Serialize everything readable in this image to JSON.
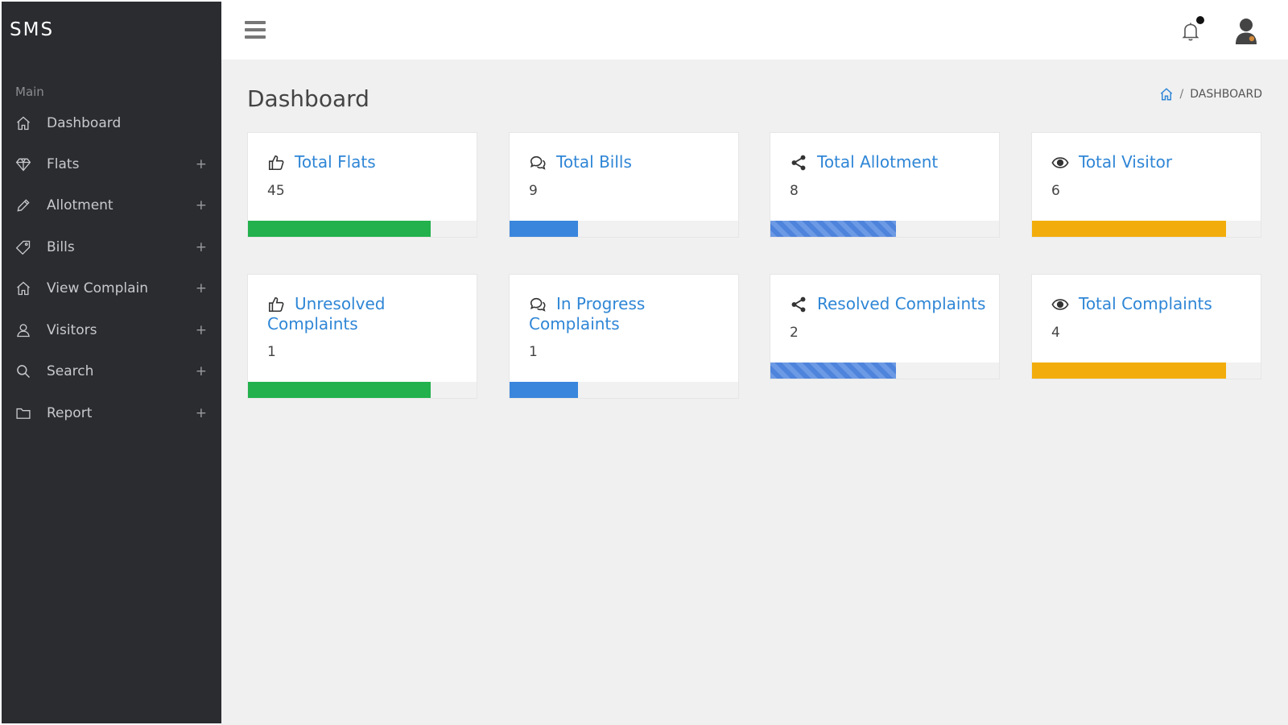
{
  "sidebar": {
    "brand": "SMS",
    "section": "Main",
    "items": [
      {
        "label": "Dashboard",
        "icon": "home-icon",
        "expandable": false
      },
      {
        "label": "Flats",
        "icon": "diamond-icon",
        "expandable": true
      },
      {
        "label": "Allotment",
        "icon": "pencil-icon",
        "expandable": true
      },
      {
        "label": "Bills",
        "icon": "tag-icon",
        "expandable": true
      },
      {
        "label": "View Complain",
        "icon": "home-icon",
        "expandable": true
      },
      {
        "label": "Visitors",
        "icon": "user-icon",
        "expandable": true
      },
      {
        "label": "Search",
        "icon": "search-icon",
        "expandable": true
      },
      {
        "label": "Report",
        "icon": "folder-icon",
        "expandable": true
      }
    ],
    "expand_symbol": "+"
  },
  "header": {
    "menu_icon": "hamburger-icon",
    "notification_icon": "bell-icon",
    "user_icon": "user-avatar-icon"
  },
  "page": {
    "title": "Dashboard",
    "breadcrumb": {
      "separator": "/",
      "current": "DASHBOARD"
    }
  },
  "cards": [
    {
      "title": "Total Flats",
      "value": "45",
      "icon": "thumbs-up-icon",
      "progress": 0.8,
      "color": "#22b14c"
    },
    {
      "title": "Total Bills",
      "value": "9",
      "icon": "comments-icon",
      "progress": 0.3,
      "color": "#3a86dc"
    },
    {
      "title": "Total Allotment",
      "value": "8",
      "icon": "share-icon",
      "progress": 0.55,
      "color": "#5a8ee0"
    },
    {
      "title": "Total Visitor",
      "value": "6",
      "icon": "eye-icon",
      "progress": 0.85,
      "color": "#f2ad0c"
    },
    {
      "title": "Unresolved Complaints",
      "value": "1",
      "icon": "thumbs-up-icon",
      "progress": 0.8,
      "color": "#22b14c"
    },
    {
      "title": "In Progress Complaints",
      "value": "1",
      "icon": "comments-icon",
      "progress": 0.3,
      "color": "#3a86dc"
    },
    {
      "title": "Resolved Complaints",
      "value": "2",
      "icon": "share-icon",
      "progress": 0.55,
      "color": "#5a8ee0"
    },
    {
      "title": "Total Complaints",
      "value": "4",
      "icon": "eye-icon",
      "progress": 0.85,
      "color": "#f2ad0c"
    }
  ]
}
